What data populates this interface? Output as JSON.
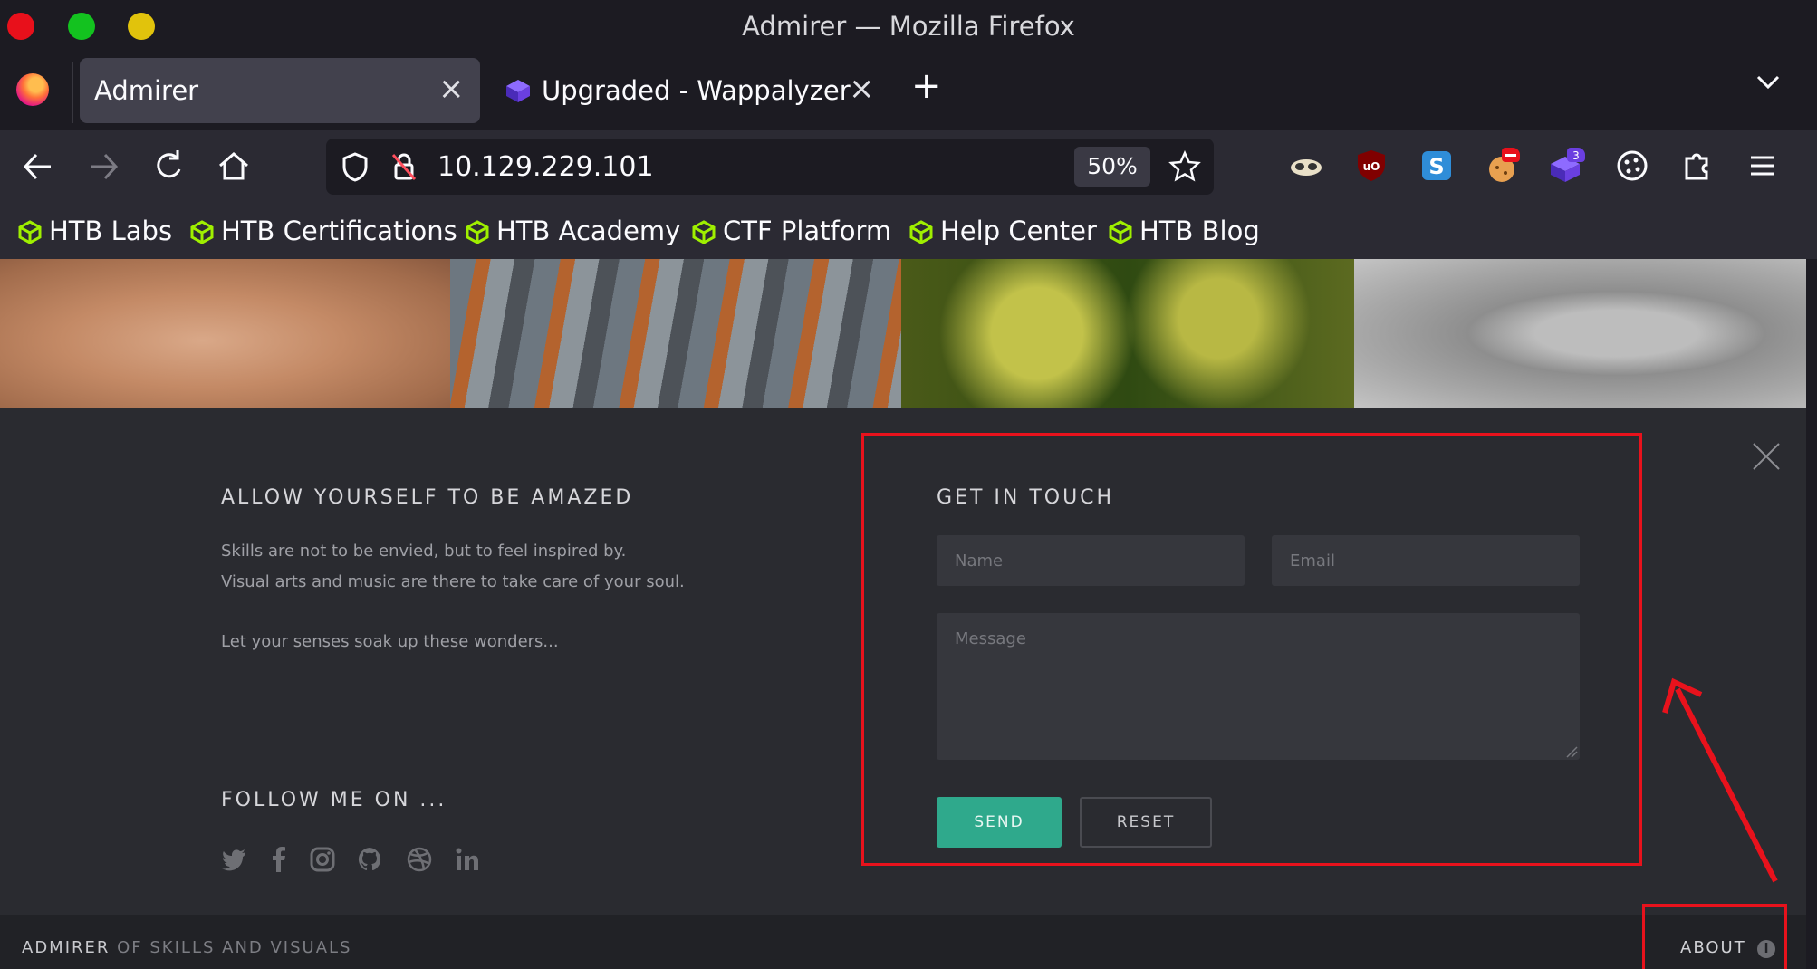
{
  "window": {
    "title": "Admirer — Mozilla Firefox"
  },
  "tabs": [
    {
      "label": "Admirer",
      "close": "×"
    },
    {
      "label": "Upgraded - Wappalyzer",
      "close": "×"
    }
  ],
  "tabbar": {
    "new_tab": "+",
    "list_all": "⌄"
  },
  "nav": {
    "url": "10.129.229.101",
    "zoom": "50%",
    "extension_badge": "3"
  },
  "bookmarks": [
    {
      "label": "HTB Labs"
    },
    {
      "label": "HTB Certifications"
    },
    {
      "label": "HTB Academy"
    },
    {
      "label": "CTF Platform"
    },
    {
      "label": "Help Center"
    },
    {
      "label": "HTB Blog"
    }
  ],
  "page": {
    "left": {
      "heading": "ALLOW YOURSELF TO BE AMAZED",
      "line1": "Skills are not to be envied, but to feel inspired by.",
      "line2": "Visual arts and music are there to take care of your soul.",
      "line3": "Let your senses soak up these wonders...",
      "follow_heading": "FOLLOW ME ON ..."
    },
    "contact": {
      "heading": "GET IN TOUCH",
      "name_placeholder": "Name",
      "email_placeholder": "Email",
      "message_placeholder": "Message",
      "send_label": "SEND",
      "reset_label": "RESET"
    },
    "footer": {
      "brand": "ADMIRER",
      "brand_sub": "OF SKILLS AND VISUALS",
      "about": "ABOUT"
    }
  },
  "colors": {
    "accent": "#2fa98c",
    "annotation": "#e8121c",
    "htb_green": "#9fef00"
  }
}
